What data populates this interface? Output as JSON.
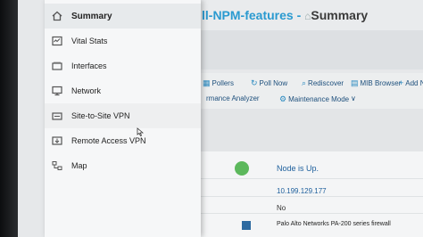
{
  "page": {
    "title_prefix": "ll-NPM-features",
    "title_sep": " - ",
    "title_home_glyph": "⌂",
    "title_summary": "Summary"
  },
  "toolbar": {
    "row1": [
      {
        "label": "Pollers",
        "icon": "pollers-icon"
      },
      {
        "label": "Poll Now",
        "icon": "poll-now-icon"
      },
      {
        "label": "Rediscover",
        "icon": "rediscover-icon"
      },
      {
        "label": "MIB Browser",
        "icon": "mib-browser-icon"
      },
      {
        "label": "Add New A",
        "icon": "add-icon"
      }
    ],
    "row2": [
      {
        "label": "rmance Analyzer",
        "icon": ""
      },
      {
        "label": "Maintenance Mode",
        "icon": "maintenance-icon"
      },
      {
        "label": "∨",
        "icon": ""
      }
    ]
  },
  "details": {
    "status": "Node is Up.",
    "ip": "10.199.129.177",
    "flag": "No",
    "vendor": "Palo Alto Networks PA-200 series firewall"
  },
  "menu": {
    "items": [
      {
        "label": "Summary",
        "icon": "home-icon"
      },
      {
        "label": "Vital Stats",
        "icon": "vital-stats-icon"
      },
      {
        "label": "Interfaces",
        "icon": "interfaces-icon"
      },
      {
        "label": "Network",
        "icon": "network-icon"
      },
      {
        "label": "Site-to-Site VPN",
        "icon": "vpn-icon"
      },
      {
        "label": "Remote Access VPN",
        "icon": "remote-access-icon"
      },
      {
        "label": "Map",
        "icon": "map-icon"
      }
    ]
  }
}
